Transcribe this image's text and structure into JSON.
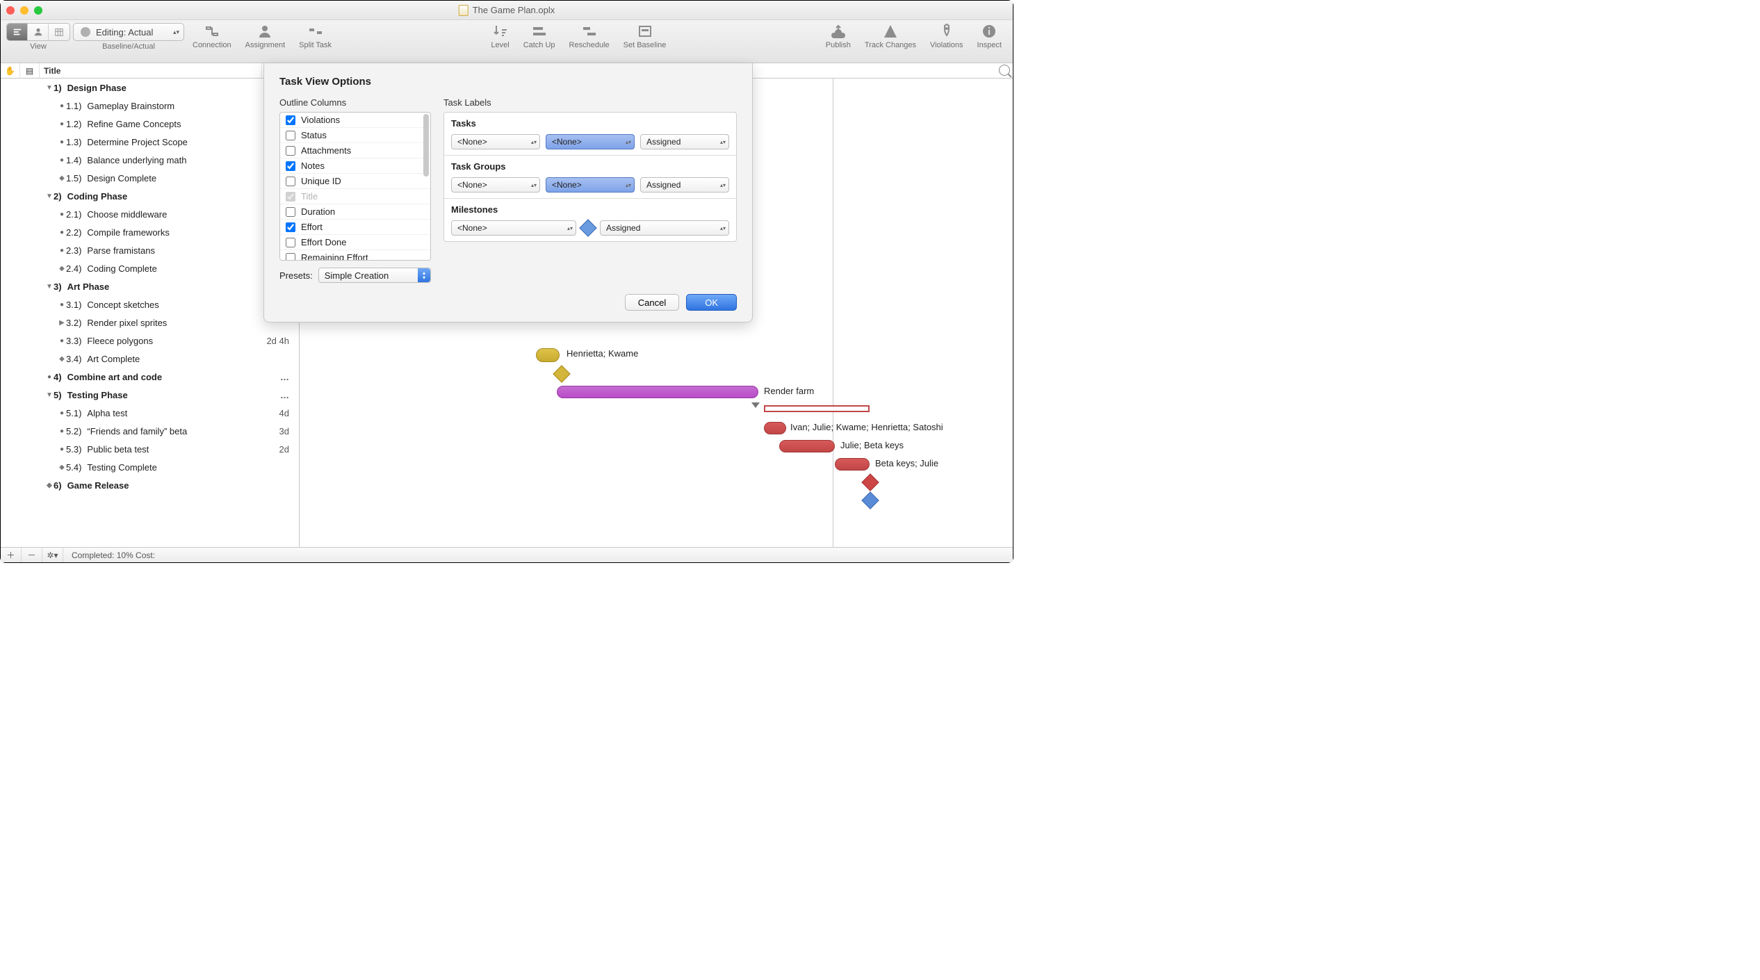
{
  "window": {
    "title": "The Game Plan.oplx"
  },
  "toolbar": {
    "view_label": "View",
    "baseline_label": "Baseline/Actual",
    "baseline_value": "Editing: Actual",
    "items": {
      "connection": "Connection",
      "assignment": "Assignment",
      "split_task": "Split Task",
      "level": "Level",
      "catch_up": "Catch Up",
      "reschedule": "Reschedule",
      "set_baseline": "Set Baseline",
      "publish": "Publish",
      "track_changes": "Track Changes",
      "violations": "Violations",
      "inspect": "Inspect"
    }
  },
  "columns": {
    "title": "Title"
  },
  "outline": [
    {
      "kind": "group",
      "num": "1)",
      "label": "Design Phase",
      "indent": 0
    },
    {
      "kind": "task",
      "num": "1.1)",
      "label": "Gameplay Brainstorm",
      "indent": 1
    },
    {
      "kind": "task",
      "num": "1.2)",
      "label": "Refine Game Concepts",
      "indent": 1
    },
    {
      "kind": "task",
      "num": "1.3)",
      "label": "Determine Project Scope",
      "indent": 1
    },
    {
      "kind": "task",
      "num": "1.4)",
      "label": "Balance underlying math",
      "indent": 1
    },
    {
      "kind": "mile",
      "num": "1.5)",
      "label": "Design Complete",
      "indent": 1
    },
    {
      "kind": "group",
      "num": "2)",
      "label": "Coding Phase",
      "indent": 0
    },
    {
      "kind": "task",
      "num": "2.1)",
      "label": "Choose middleware",
      "indent": 1
    },
    {
      "kind": "task",
      "num": "2.2)",
      "label": "Compile frameworks",
      "indent": 1
    },
    {
      "kind": "task",
      "num": "2.3)",
      "label": "Parse framistans",
      "indent": 1
    },
    {
      "kind": "mile",
      "num": "2.4)",
      "label": "Coding Complete",
      "indent": 1
    },
    {
      "kind": "group",
      "num": "3)",
      "label": "Art Phase",
      "indent": 0
    },
    {
      "kind": "task",
      "num": "3.1)",
      "label": "Concept sketches",
      "indent": 1
    },
    {
      "kind": "sub",
      "num": "3.2)",
      "label": "Render pixel sprites",
      "indent": 1
    },
    {
      "kind": "task",
      "num": "3.3)",
      "label": "Fleece polygons",
      "indent": 1,
      "dur": "2d 4h"
    },
    {
      "kind": "mile",
      "num": "3.4)",
      "label": "Art Complete",
      "indent": 1
    },
    {
      "kind": "leaf",
      "num": "4)",
      "label": "Combine art and code",
      "indent": 0,
      "dur": "…"
    },
    {
      "kind": "group",
      "num": "5)",
      "label": "Testing Phase",
      "indent": 0,
      "dur": "…"
    },
    {
      "kind": "task",
      "num": "5.1)",
      "label": "Alpha test",
      "indent": 1,
      "dur": "4d"
    },
    {
      "kind": "task",
      "num": "5.2)",
      "label": "“Friends and family” beta",
      "indent": 1,
      "dur": "3d"
    },
    {
      "kind": "task",
      "num": "5.3)",
      "label": "Public beta test",
      "indent": 1,
      "dur": "2d"
    },
    {
      "kind": "mile",
      "num": "5.4)",
      "label": "Testing Complete",
      "indent": 1
    },
    {
      "kind": "mile",
      "num": "6)",
      "label": "Game Release",
      "indent": 0
    }
  ],
  "gantt_labels": {
    "hk": "Henrietta; Kwame",
    "render_farm": "Render farm",
    "ivan": "Ivan; Julie; Kwame; Henrietta; Satoshi",
    "julie_beta": "Julie; Beta keys",
    "beta_julie": "Beta keys; Julie"
  },
  "dialog": {
    "title": "Task View Options",
    "left_header": "Outline Columns",
    "columns": [
      {
        "label": "Violations",
        "checked": true
      },
      {
        "label": "Status",
        "checked": false
      },
      {
        "label": "Attachments",
        "checked": false
      },
      {
        "label": "Notes",
        "checked": true
      },
      {
        "label": "Unique ID",
        "checked": false
      },
      {
        "label": "Title",
        "checked": true,
        "disabled": true
      },
      {
        "label": "Duration",
        "checked": false
      },
      {
        "label": "Effort",
        "checked": true
      },
      {
        "label": "Effort Done",
        "checked": false
      },
      {
        "label": "Remaining Effort",
        "checked": false
      }
    ],
    "presets_label": "Presets:",
    "presets_value": "Simple Creation",
    "right_header": "Task Labels",
    "tasks": {
      "title": "Tasks",
      "left": "<None>",
      "mid": "<None>",
      "right": "Assigned"
    },
    "groups": {
      "title": "Task Groups",
      "left": "<None>",
      "mid": "<None>",
      "right": "Assigned"
    },
    "milestones": {
      "title": "Milestones",
      "left": "<None>",
      "right": "Assigned"
    },
    "cancel": "Cancel",
    "ok": "OK"
  },
  "status": {
    "text": "Completed: 10% Cost:"
  }
}
